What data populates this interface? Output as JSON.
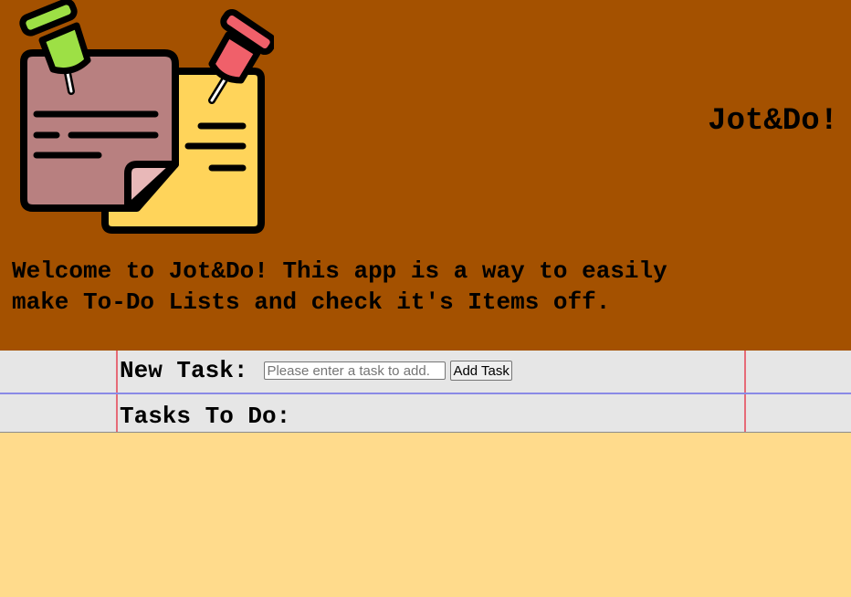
{
  "header": {
    "logo_icon": "sticky-notes-with-pins-icon",
    "app_title": "Jot&Do!",
    "welcome_text": "Welcome to Jot&Do! This app is a way to easily make To-Do Lists and check it's Items off."
  },
  "form": {
    "new_task_label": "New Task:",
    "input_placeholder": "Please enter a task to add.",
    "input_value": "",
    "add_button_label": "Add Task"
  },
  "list": {
    "heading": "Tasks To Do:",
    "items": []
  },
  "colors": {
    "header_bg": "#a45100",
    "notepad_bg": "#e6e6e6",
    "margin_line": "#e66b78",
    "rule_line": "#8a8ae6",
    "page_bg": "#ffdb8c"
  }
}
